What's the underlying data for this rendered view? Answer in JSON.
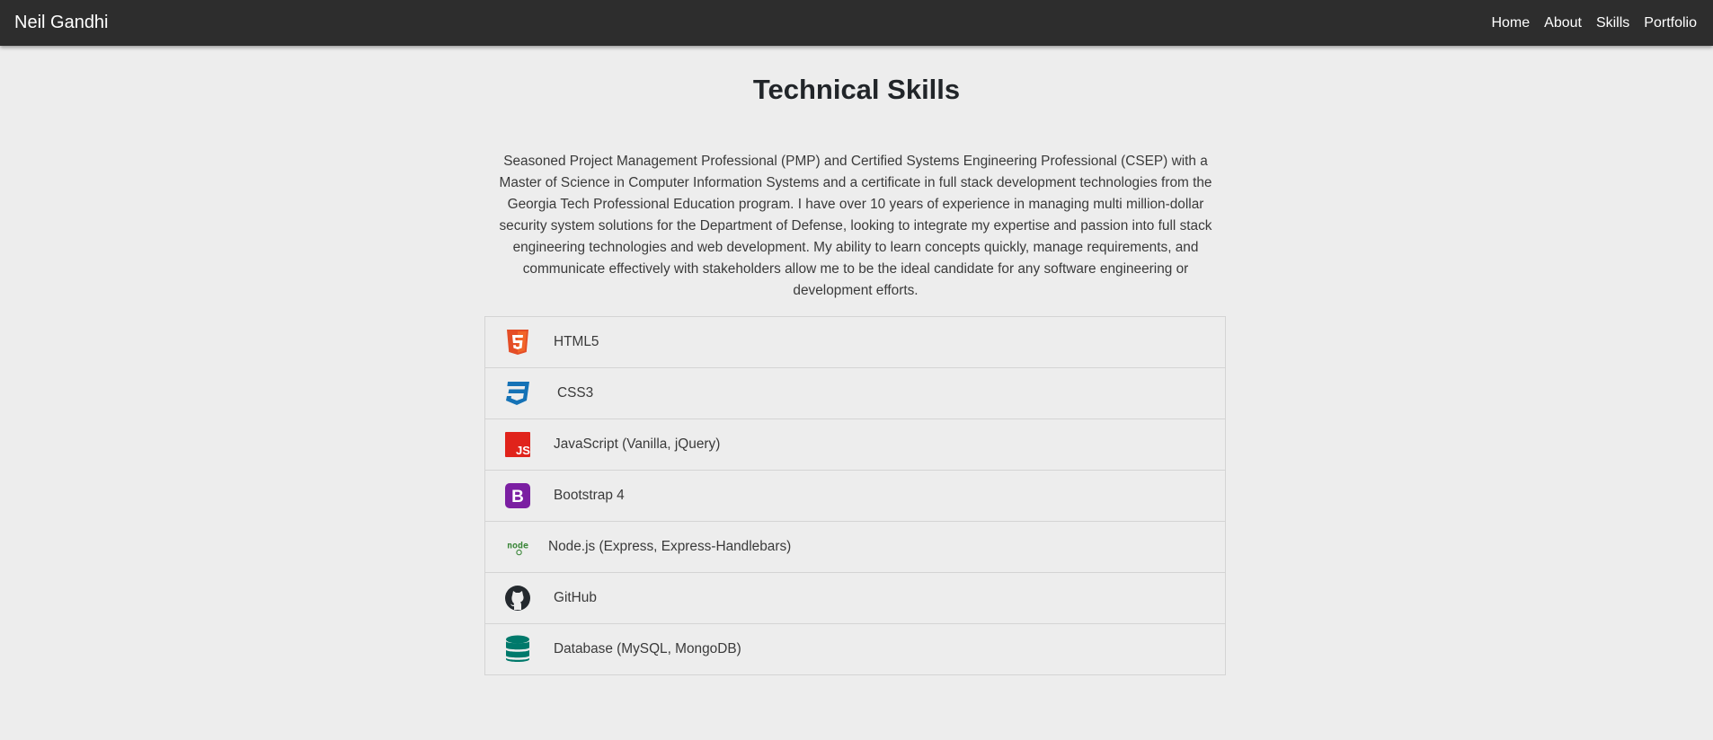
{
  "nav": {
    "brand": "Neil Gandhi",
    "links": [
      "Home",
      "About",
      "Skills",
      "Portfolio"
    ]
  },
  "main": {
    "title": "Technical Skills",
    "bio": "Seasoned Project Management Professional (PMP) and Certified Systems Engineering Professional (CSEP) with a Master of Science in Computer Information Systems and a certificate in full stack development technologies from the Georgia Tech Professional Education program. I have over 10 years of experience in managing multi million-dollar security system solutions for the Department of Defense, looking to integrate my expertise and passion into full stack engineering technologies and web development. My ability to learn concepts quickly, manage requirements, and communicate effectively with stakeholders allow me to be the ideal candidate for any software engineering or development efforts."
  },
  "skills": [
    {
      "label": "HTML5",
      "icon": "html5-icon",
      "color": "#e44d26"
    },
    {
      "label": "CSS3",
      "icon": "css3-icon",
      "color": "#1572b6"
    },
    {
      "label": "JavaScript (Vanilla, jQuery)",
      "icon": "javascript-icon",
      "color": "#e0231b"
    },
    {
      "label": "Bootstrap 4",
      "icon": "bootstrap-icon",
      "color": "#7b1fa2"
    },
    {
      "label": "Node.js (Express, Express-Handlebars)",
      "icon": "nodejs-icon",
      "color": "#3c873a"
    },
    {
      "label": "GitHub",
      "icon": "github-icon",
      "color": "#24292e"
    },
    {
      "label": "Database (MySQL, MongoDB)",
      "icon": "database-icon",
      "color": "#00796b"
    }
  ]
}
